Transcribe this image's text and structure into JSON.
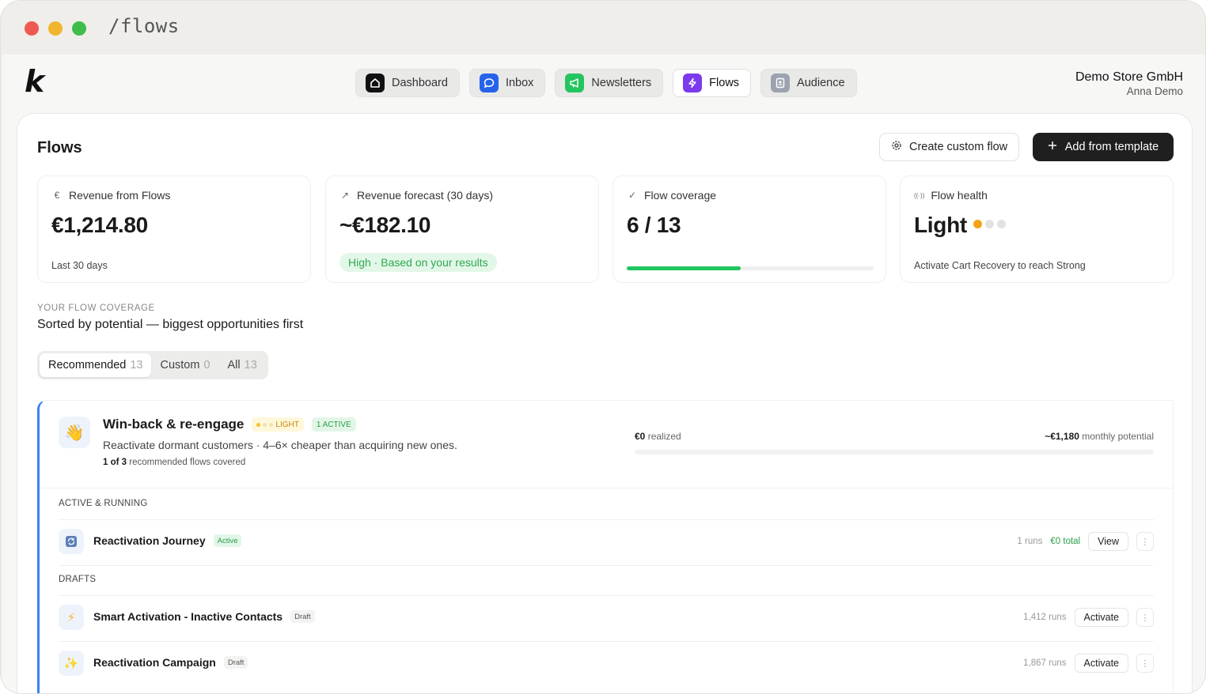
{
  "window": {
    "title": "/flows"
  },
  "brand": {
    "logo": "k"
  },
  "nav": [
    {
      "label": "Dashboard",
      "icon": "home-icon",
      "color": "#111111"
    },
    {
      "label": "Inbox",
      "icon": "chat-bubble-icon",
      "color": "#2563eb"
    },
    {
      "label": "Newsletters",
      "icon": "megaphone-icon",
      "color": "#22c55e"
    },
    {
      "label": "Flows",
      "icon": "lightning-icon",
      "color": "#7c3aed"
    },
    {
      "label": "Audience",
      "icon": "contact-card-icon",
      "color": "#9ca3af"
    }
  ],
  "account": {
    "store": "Demo Store GmbH",
    "user": "Anna Demo"
  },
  "page": {
    "title": "Flows",
    "create_custom_label": "Create custom flow",
    "add_template_label": "Add from template"
  },
  "stats": {
    "revenue": {
      "icon": "€",
      "label": "Revenue from Flows",
      "value": "€1,214.80",
      "sub": "Last 30 days"
    },
    "forecast": {
      "icon": "↗",
      "label": "Revenue forecast (30 days)",
      "value": "~€182.10",
      "pill": "High · Based on your results"
    },
    "coverage": {
      "icon": "✓",
      "label": "Flow coverage",
      "value": "6 / 13",
      "progress": 0.46
    },
    "health": {
      "icon": "((·))",
      "label": "Flow health",
      "value": "Light",
      "level": 1,
      "max": 3,
      "sub": "Activate Cart Recovery to reach Strong"
    }
  },
  "section": {
    "kicker": "YOUR FLOW COVERAGE",
    "title": "Sorted by potential — biggest opportunities first"
  },
  "filters": [
    {
      "label": "Recommended",
      "count": "13"
    },
    {
      "label": "Custom",
      "count": "0"
    },
    {
      "label": "All",
      "count": "13"
    }
  ],
  "group": {
    "icon": "waving-hand-icon",
    "title": "Win-back & re-engage",
    "badge_light": "LIGHT",
    "badge_active": "1 ACTIVE",
    "description": "Reactivate dormant customers · 4–6× cheaper than acquiring new ones.",
    "covered_count": "1 of 3",
    "covered_text": "recommended flows covered",
    "realized_value": "€0",
    "realized_text": "realized",
    "potential_value": "~€1,180",
    "potential_text": "monthly potential",
    "potential_progress": 0,
    "active_heading": "ACTIVE & RUNNING",
    "drafts_heading": "DRAFTS",
    "active_flows": [
      {
        "name": "Reactivation Journey",
        "status": "Active",
        "runs": "1 runs",
        "total": "€0 total",
        "action": "View",
        "icon": "refresh-icon"
      }
    ],
    "draft_flows": [
      {
        "name": "Smart Activation - Inactive Contacts",
        "status": "Draft",
        "runs": "1,412 runs",
        "action": "Activate",
        "icon": "lightning-icon"
      },
      {
        "name": "Reactivation Campaign",
        "status": "Draft",
        "runs": "1,867 runs",
        "action": "Activate",
        "icon": "sparkle-icon"
      }
    ]
  }
}
